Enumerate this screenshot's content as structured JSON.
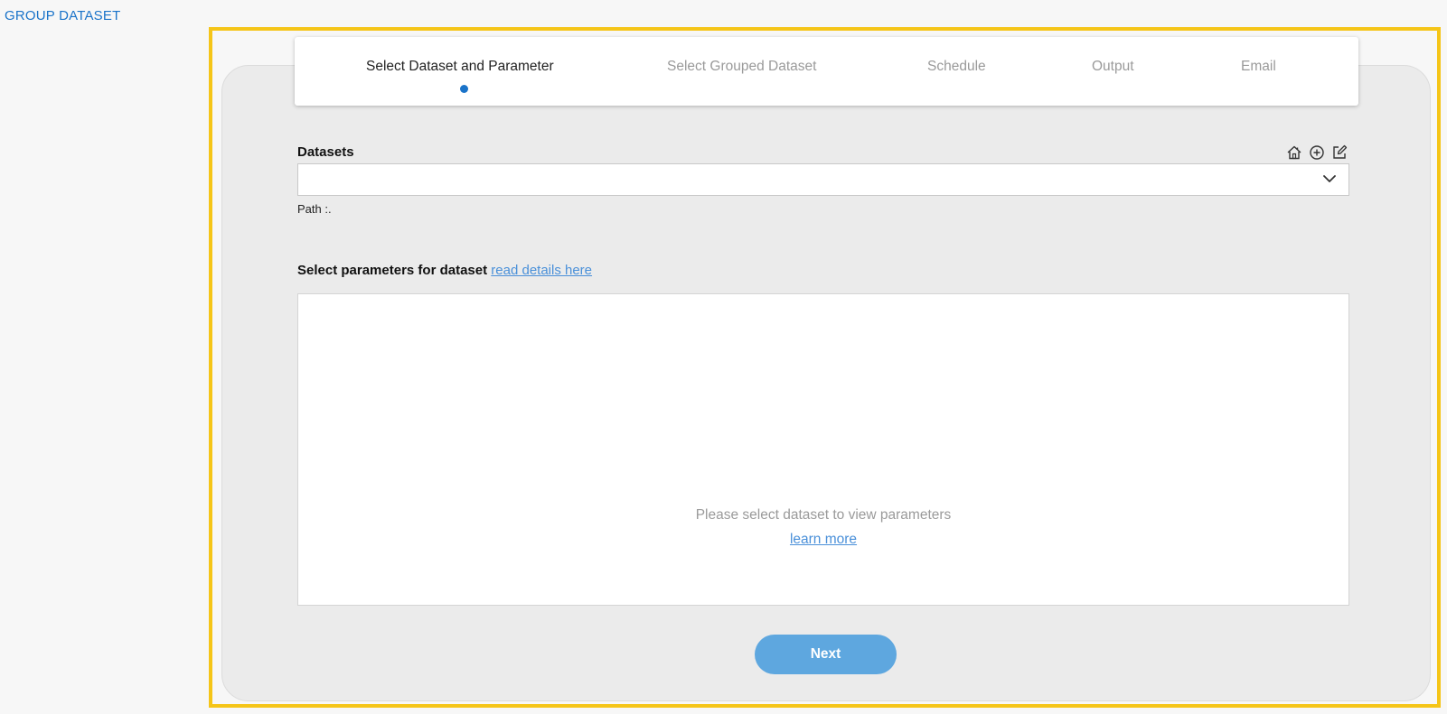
{
  "page": {
    "title": "GROUP DATASET"
  },
  "stepper": {
    "steps": [
      {
        "label": "Select Dataset and Parameter",
        "active": true
      },
      {
        "label": "Select Grouped Dataset",
        "active": false
      },
      {
        "label": "Schedule",
        "active": false
      },
      {
        "label": "Output",
        "active": false
      },
      {
        "label": "Email",
        "active": false
      }
    ]
  },
  "datasets": {
    "label": "Datasets",
    "selected_value": "",
    "path_label": "Path :.",
    "icons": [
      "home-icon",
      "add-circle-icon",
      "edit-icon"
    ]
  },
  "parameters": {
    "label": "Select parameters for dataset",
    "details_link": "read details here",
    "empty_message": "Please select dataset to view parameters",
    "learn_more_link": "learn more"
  },
  "actions": {
    "next_label": "Next"
  },
  "colors": {
    "accent": "#1a73c9",
    "button": "#5ea7df",
    "highlight": "#f5c518",
    "link": "#4a90d9"
  }
}
